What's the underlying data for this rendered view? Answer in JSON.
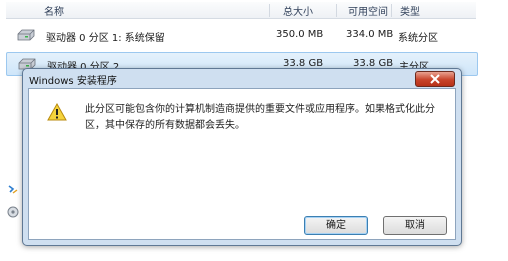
{
  "table": {
    "columns": [
      "名称",
      "总大小",
      "可用空间",
      "类型"
    ],
    "rows": [
      {
        "name": "驱动器 0 分区 1: 系统保留",
        "total": "350.0 MB",
        "free": "334.0 MB",
        "type": "系统分区",
        "icon": "drive-icon"
      },
      {
        "name": "驱动器 0 分区 2",
        "total": "33.8 GB",
        "free": "33.8 GB",
        "type": "主分区",
        "icon": "drive-icon"
      }
    ]
  },
  "dialog": {
    "title": "Windows 安装程序",
    "message": "此分区可能包含你的计算机制造商提供的重要文件或应用程序。如果格式化此分区，其中保存的所有数据都会丢失。",
    "ok_label": "确定",
    "cancel_label": "取消",
    "icon": "warning-icon"
  },
  "colors": {
    "selection": "#cfe6fa",
    "dialog_frame": "#cfdff0",
    "close_button": "#c8442b"
  }
}
